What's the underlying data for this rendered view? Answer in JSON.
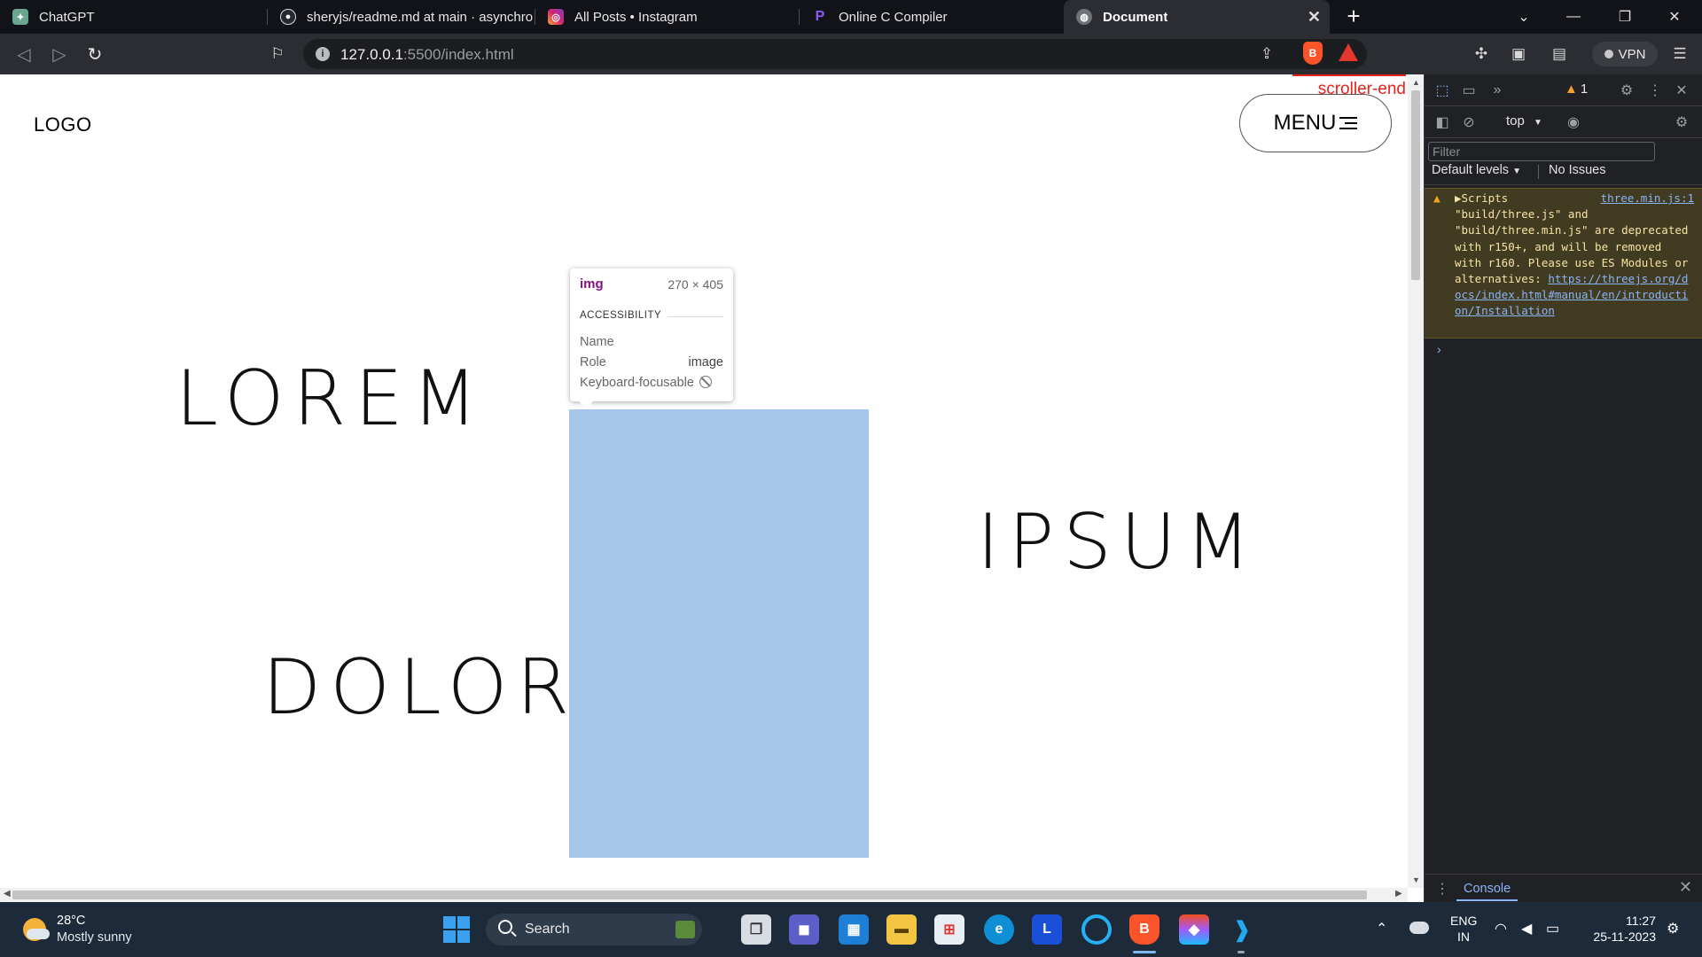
{
  "browser": {
    "tabs": [
      {
        "label": "ChatGPT",
        "icon": "chatgpt-icon",
        "color": "#6aa68f",
        "active": false
      },
      {
        "label": "sheryjs/readme.md at main · asynchro",
        "icon": "github-icon",
        "color": "#24292f",
        "active": false
      },
      {
        "label": "All Posts • Instagram",
        "icon": "instagram-icon",
        "color": "#d6266d",
        "active": false
      },
      {
        "label": "Online C Compiler",
        "icon": "compiler-icon",
        "color": "#6b3fc9",
        "active": false
      },
      {
        "label": "Document",
        "icon": "globe-icon",
        "color": "#6f7278",
        "active": true
      }
    ],
    "new_tab_label": "+",
    "url_host": "127.0.0.1",
    "url_path": ":5500/index.html",
    "vpn_label": "VPN"
  },
  "page": {
    "logo": "LOGO",
    "menu_label": "MENU",
    "marker_label": "scroller-end",
    "words": [
      "LOREM",
      "IPSUM",
      "DOLOR"
    ],
    "image_color": "#a5c6e8"
  },
  "inspect_tooltip": {
    "tag": "img",
    "dimensions": "270 × 405",
    "section_title": "ACCESSIBILITY",
    "rows": [
      {
        "label": "Name",
        "value": ""
      },
      {
        "label": "Role",
        "value": "image"
      },
      {
        "label": "Keyboard-focusable",
        "value": ""
      }
    ]
  },
  "devtools": {
    "warning_count": "1",
    "context": "top",
    "filter_placeholder": "Filter",
    "levels_label": "Default levels",
    "issues_label": "No Issues",
    "warning_group": "Scripts",
    "warning_source": "three.min.js:1",
    "warning_text": "\"build/three.js\" and \"build/three.min.js\" are deprecated with r150+, and will be removed with r160. Please use ES Modules or alternatives: ",
    "warning_link": "https://threejs.org/docs/index.html#manual/en/introduction/Installation",
    "drawer_tab": "Console"
  },
  "taskbar": {
    "temperature": "28°C",
    "weather": "Mostly sunny",
    "search_label": "Search",
    "language_line1": "ENG",
    "language_line2": "IN",
    "time": "11:27",
    "date": "25-11-2023"
  }
}
